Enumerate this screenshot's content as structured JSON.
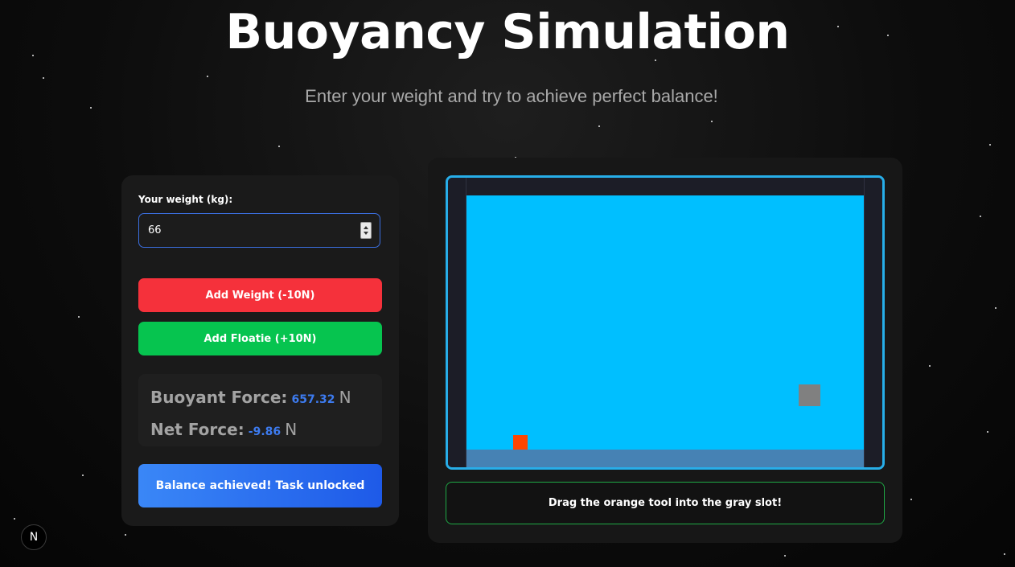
{
  "header": {
    "title": "Buoyancy Simulation",
    "subtitle": "Enter your weight and try to achieve perfect balance!"
  },
  "controls": {
    "weight_label": "Your weight (kg):",
    "weight_value": "66",
    "add_weight_label": "Add Weight (-10N)",
    "add_floatie_label": "Add Floatie (+10N)",
    "buoyant_force_label": "Buoyant Force:",
    "buoyant_force_value": "657.32",
    "net_force_label": "Net Force:",
    "net_force_value": "-9.86",
    "force_unit": "N",
    "status_button_label": "Balance achieved! Task unlocked"
  },
  "simulation": {
    "instruction": "Drag the orange tool into the gray slot!",
    "water_color": "#00bfff",
    "floor_color": "#4682b4",
    "tool_color": "#ff4500",
    "slot_color": "#808080",
    "tank_border_color": "#27aee9"
  },
  "colors": {
    "add_weight": "#f5313b",
    "add_floatie": "#06c44f",
    "status_button": "#2563eb",
    "force_value": "#3d7bef",
    "instruction_border": "#1fa845"
  },
  "badge": {
    "letter": "N"
  }
}
